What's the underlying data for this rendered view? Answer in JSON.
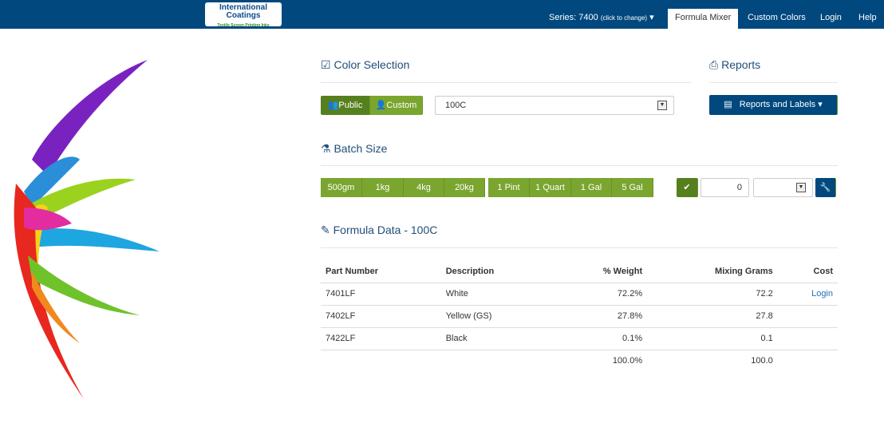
{
  "nav": {
    "logo_line1": "International",
    "logo_line2": "Coatings",
    "logo_tagline": "Textile Screen Printing Inks",
    "series": "Series: 7400",
    "series_hint": "(click to change)",
    "items": [
      "Formula Mixer",
      "Custom Colors",
      "Login",
      "Help"
    ],
    "active": "Formula Mixer"
  },
  "color_selection": {
    "title": "Color Selection",
    "public": "Public",
    "custom": "Custom",
    "selected": "100C"
  },
  "reports": {
    "title": "Reports",
    "button": "Reports and Labels"
  },
  "batch": {
    "title": "Batch Size",
    "weights": [
      "500gm",
      "1kg",
      "4kg",
      "20kg"
    ],
    "volumes": [
      "1 Pint",
      "1 Quart",
      "1 Gal",
      "5 Gal"
    ],
    "custom_value": "0",
    "unit": ""
  },
  "formula": {
    "title": "Formula Data - 100C",
    "headers": [
      "Part Number",
      "Description",
      "% Weight",
      "Mixing Grams",
      "Cost"
    ],
    "rows": [
      [
        "7401LF",
        "White",
        "72.2%",
        "72.2",
        "Login"
      ],
      [
        "7402LF",
        "Yellow (GS)",
        "27.8%",
        "27.8",
        ""
      ],
      [
        "7422LF",
        "Black",
        "0.1%",
        "0.1",
        ""
      ]
    ],
    "totals": [
      "",
      "",
      "100.0%",
      "100.0",
      ""
    ]
  },
  "colors": {
    "navbar": "#00487e",
    "green": "#7aa52f",
    "green_active": "#567f1e",
    "title": "#1f4e79"
  }
}
